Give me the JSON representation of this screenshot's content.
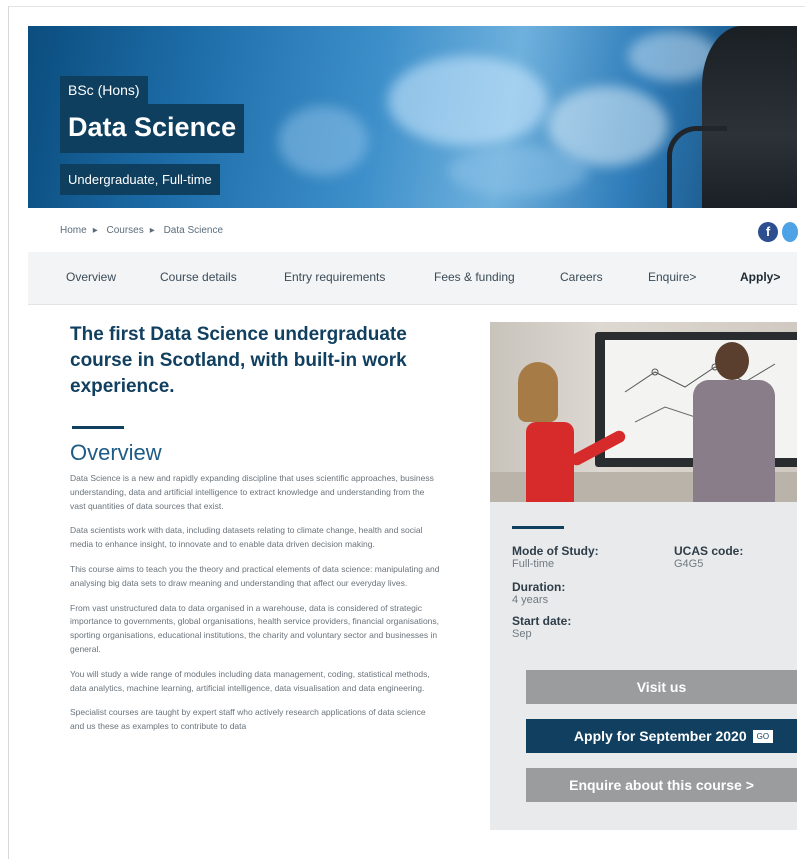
{
  "hero": {
    "degree": "BSc (Hons)",
    "title": "Data Science",
    "mode": "Undergraduate, Full-time"
  },
  "breadcrumb": [
    "Home",
    "Courses",
    "Data Science"
  ],
  "social": {
    "facebook_glyph": "f"
  },
  "nav": {
    "items": [
      "Overview",
      "Course details",
      "Entry requirements",
      "Fees & funding",
      "Careers",
      "Enquire>"
    ],
    "apply": "Apply>"
  },
  "main": {
    "headline": "The first Data Science undergraduate course in Scotland, with built-in work experience.",
    "section_title": "Overview",
    "paragraphs": [
      "Data Science is a new and rapidly expanding discipline that uses scientific approaches, business understanding, data and artificial intelligence to extract knowledge and understanding from the vast quantities of data sources that exist.",
      "Data scientists work with data, including datasets relating to climate change, health and social media to enhance insight, to innovate and to enable data driven decision making.",
      "This course aims to teach you the theory and practical elements of data science: manipulating and analysing big data sets to draw meaning and understanding that affect our everyday lives.",
      "From vast unstructured data to data organised in a warehouse, data is considered of strategic importance to governments, global organisations, health service providers, financial organisations, sporting organisations, educational institutions, the charity and voluntary sector and businesses in general.",
      "You will study a wide range of modules including data management, coding, statistical methods, data analytics, machine learning, artificial intelligence, data visualisation and data engineering.",
      "Specialist courses are taught by expert staff who actively research applications of data science and us these as examples to contribute to data"
    ]
  },
  "info": {
    "mode_label": "Mode of Study:",
    "mode_value": "Full-time",
    "ucas_label": "UCAS code:",
    "ucas_value": "G4G5",
    "duration_label": "Duration:",
    "duration_value": "4 years",
    "start_label": "Start date:",
    "start_value": "Sep"
  },
  "buttons": {
    "visit": "Visit us",
    "apply": "Apply for September 2020",
    "apply_badge": "GO",
    "enquire": "Enquire about this course >"
  },
  "colors": {
    "brand_navy": "#103f5f",
    "button_grey": "#9a9c9e",
    "panel_bg": "#e9eaeb"
  }
}
